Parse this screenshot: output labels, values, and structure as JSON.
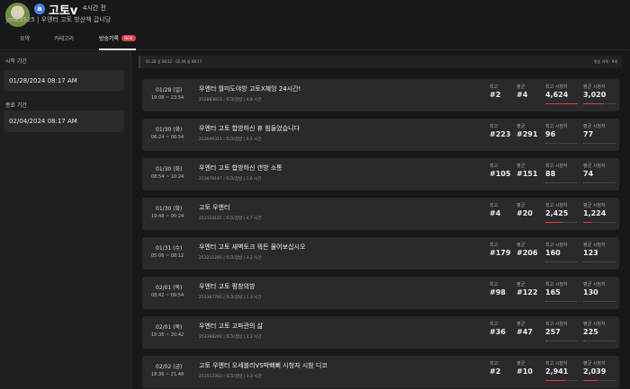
{
  "header": {
    "platform_badge": "a",
    "channel_name": "고토v",
    "live_ago": "4시간 전",
    "channel_sub": "ymk3525 | 우엔터 고토 방산책 갑니당"
  },
  "tabs": [
    {
      "label": "요약"
    },
    {
      "label": "카테고리"
    },
    {
      "label": "방송기록",
      "badge": "NEW",
      "active": true
    }
  ],
  "sidebar": {
    "start_label": "시작 기간",
    "start_value": "01/28/2024  08:17 AM",
    "end_label": "종료 기간",
    "end_value": "02/04/2024  08:17 AM"
  },
  "summary": {
    "range": "01.28 일 08:12 - 02.04 일 08:17",
    "count": "방송 기록 : 9개"
  },
  "labels": {
    "peak_rank": "최고",
    "avg_rank": "평균",
    "peak_viewers": "최고 시청자",
    "avg_viewers": "평균 시청자"
  },
  "colors": {
    "accent_bar": "#e03c3c",
    "platform": "#3b82f6",
    "new_badge": "#e23b4a"
  },
  "broadcasts": [
    {
      "date": "01/28 (일)",
      "time": "19:08 ~ 23:54",
      "title": "우엔터 월미도야방 고토X혜잉 24시간!",
      "meta": "252883823 | 토크/잡방 | 4.8 시간",
      "peak_rank": "#2",
      "avg_rank": "#4",
      "peak_viewers": "4,624",
      "avg_viewers": "3,020",
      "peak_level": 1.0,
      "avg_level": 0.65
    },
    {
      "date": "01/30 (화)",
      "time": "06:24 ~ 06:54",
      "title": "우엔터 고토 합방하신 휴 힘들었습니다",
      "meta": "253049311 | 토크/잡방 | 0.5 시간",
      "peak_rank": "#223",
      "avg_rank": "#291",
      "peak_viewers": "96",
      "avg_viewers": "77",
      "peak_level": 0.02,
      "avg_level": 0.02
    },
    {
      "date": "01/30 (화)",
      "time": "08:54 ~ 10:24",
      "title": "우엔터 고토 합방하신 갠방 소통",
      "meta": "253070147 | 토크/잡방 | 1.6 시간",
      "peak_rank": "#105",
      "avg_rank": "#151",
      "peak_viewers": "88",
      "avg_viewers": "74",
      "peak_level": 0.02,
      "avg_level": 0.02
    },
    {
      "date": "01/30 (화)",
      "time": "19:48 ~ 00:24",
      "title": "고토 우엔터",
      "meta": "253124125 | 토크/잡방 | 4.7 시간",
      "peak_rank": "#4",
      "avg_rank": "#20",
      "peak_viewers": "2,425",
      "avg_viewers": "1,224",
      "peak_level": 0.52,
      "avg_level": 0.26
    },
    {
      "date": "01/31 (수)",
      "time": "05:06 ~ 08:12",
      "title": "우엔터 고토 새벽토크 뭐든 물어보십시오",
      "meta": "253211285 | 토크/잡방 | 3.2 시간",
      "peak_rank": "#179",
      "avg_rank": "#206",
      "peak_viewers": "160",
      "avg_viewers": "123",
      "peak_level": 0.03,
      "avg_level": 0.03
    },
    {
      "date": "02/01 (목)",
      "time": "08:42 ~ 09:54",
      "title": "우엔터 고토 평창의방",
      "meta": "253367795 | 토크/잡방 | 1.3 시간",
      "peak_rank": "#98",
      "avg_rank": "#122",
      "peak_viewers": "165",
      "avg_viewers": "130",
      "peak_level": 0.04,
      "avg_level": 0.03
    },
    {
      "date": "02/01 (목)",
      "time": "18:36 ~ 20:42",
      "title": "우엔터 고토 고파관의 삶",
      "meta": "253398291 | 토크/잡방 | 2.2 시간",
      "peak_rank": "#36",
      "avg_rank": "#47",
      "peak_viewers": "257",
      "avg_viewers": "225",
      "peak_level": 0.06,
      "avg_level": 0.05
    },
    {
      "date": "02/02 (금)",
      "time": "18:36 ~ 21:48",
      "title": "고토 우엔터 오세블리VS박뻐뻐 시청자 시참 디코",
      "meta": "253512363 | 토크/잡방 | 3.3 시간",
      "peak_rank": "#2",
      "avg_rank": "#10",
      "peak_viewers": "2,941",
      "avg_viewers": "2,039",
      "peak_level": 0.64,
      "avg_level": 0.44
    }
  ]
}
